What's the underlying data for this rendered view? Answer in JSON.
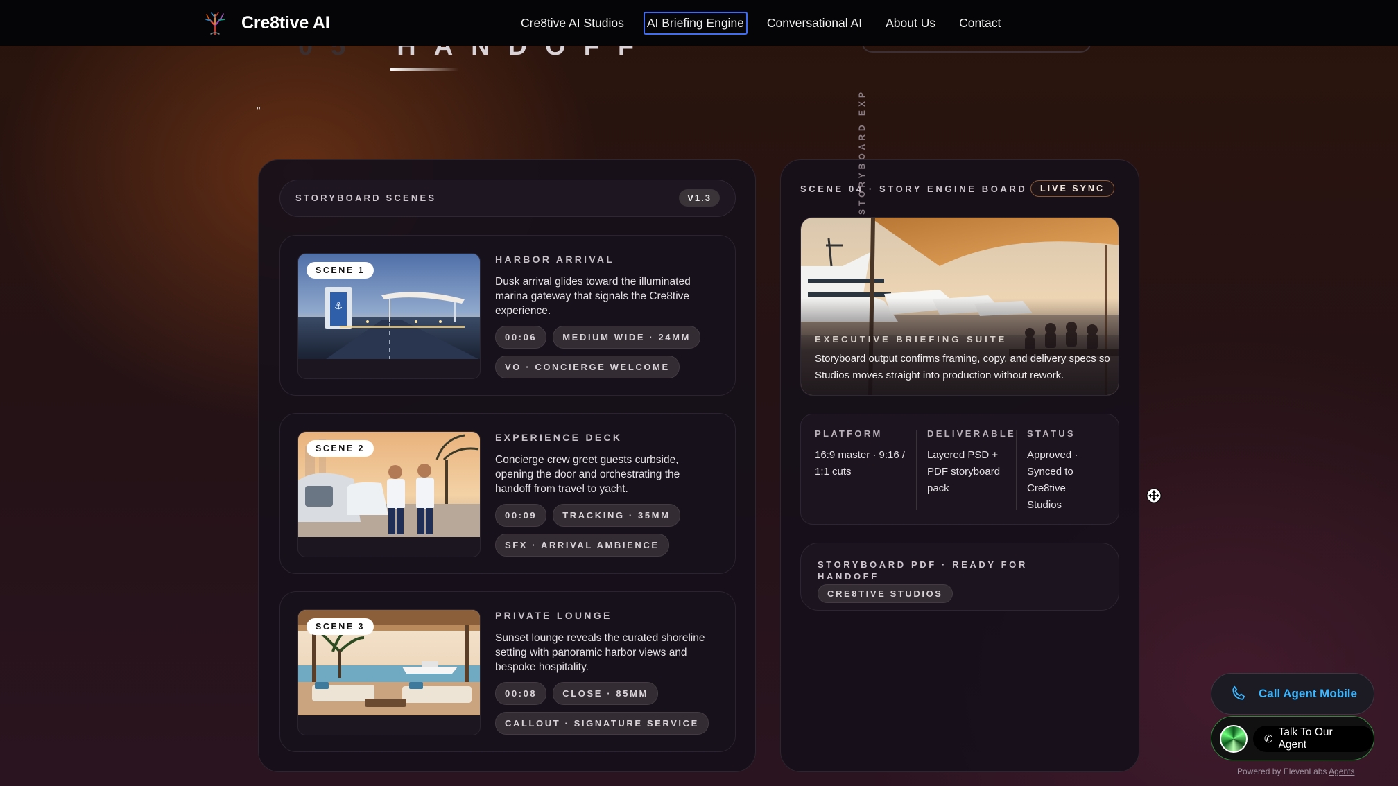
{
  "header": {
    "brand": "Cre8tive AI",
    "nav": [
      {
        "label": "Cre8tive AI Studios",
        "active": false
      },
      {
        "label": "AI Briefing Engine",
        "active": true
      },
      {
        "label": "Conversational AI",
        "active": false
      },
      {
        "label": "About Us",
        "active": false
      },
      {
        "label": "Contact",
        "active": false
      }
    ]
  },
  "hero": {
    "title_ghost": "05",
    "title": "HANDOFF",
    "quote": "\""
  },
  "vertical_label": "STORYBOARD EXPORT",
  "storyboard": {
    "label": "STORYBOARD SCENES",
    "version": "V1.3",
    "scenes": [
      {
        "badge": "SCENE 1",
        "title": "HARBOR ARRIVAL",
        "desc": "Dusk arrival glides toward the illuminated marina gateway that signals the Cre8tive experience.",
        "tags": [
          "00:06",
          "MEDIUM WIDE · 24MM",
          "VO · CONCIERGE WELCOME"
        ]
      },
      {
        "badge": "SCENE 2",
        "title": "EXPERIENCE DECK",
        "desc": "Concierge crew greet guests curbside, opening the door and orchestrating the handoff from travel to yacht.",
        "tags": [
          "00:09",
          "TRACKING · 35MM",
          "SFX · ARRIVAL AMBIENCE"
        ]
      },
      {
        "badge": "SCENE 3",
        "title": "PRIVATE LOUNGE",
        "desc": "Sunset lounge reveals the curated shoreline setting with panoramic harbor views and bespoke hospitality.",
        "tags": [
          "00:08",
          "CLOSE · 85MM",
          "CALLOUT · SIGNATURE SERVICE"
        ]
      }
    ]
  },
  "board": {
    "label": "SCENE 04 · STORY ENGINE BOARD",
    "badge": "LIVE SYNC",
    "hero_title": "EXECUTIVE BRIEFING SUITE",
    "hero_desc": "Storyboard output confirms framing, copy, and delivery specs so Studios moves straight into production without rework.",
    "specs": [
      {
        "key": "PLATFORM",
        "value": "16:9 master · 9:16 / 1:1 cuts"
      },
      {
        "key": "DELIVERABLE",
        "value": "Layered PSD + PDF storyboard pack"
      },
      {
        "key": "STATUS",
        "value": "Approved · Synced to Cre8tive Studios"
      }
    ],
    "pdf_title": "STORYBOARD PDF · READY FOR HANDOFF",
    "pdf_tag": "CRE8TIVE STUDIOS"
  },
  "agent": {
    "call_label": "Call Agent Mobile",
    "talk_label": "Talk To Our Agent",
    "powered_prefix": "Powered by ElevenLabs ",
    "powered_link": "Agents"
  },
  "colors": {
    "accent_link": "#3cb7ff",
    "active_nav_outline": "#3e6cf2",
    "widget_border": "#2e8a3c"
  }
}
